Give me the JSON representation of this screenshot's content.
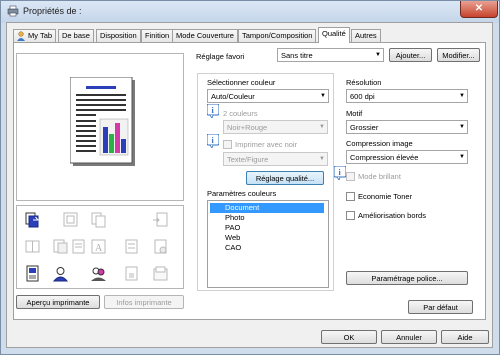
{
  "window": {
    "title": "Propriétés de :",
    "close_glyph": "✕"
  },
  "tabs": [
    {
      "label": "My Tab"
    },
    {
      "label": "De base"
    },
    {
      "label": "Disposition"
    },
    {
      "label": "Finition"
    },
    {
      "label": "Mode Couverture"
    },
    {
      "label": "Tampon/Composition"
    },
    {
      "label": "Qualité"
    },
    {
      "label": "Autres"
    }
  ],
  "favorite": {
    "label": "Réglage favori",
    "value": "Sans titre",
    "add_button": "Ajouter...",
    "modify_button": "Modifier..."
  },
  "color": {
    "select_label": "Sélectionner couleur",
    "select_value": "Auto/Couleur",
    "two_colors_label": "2 couleurs",
    "two_colors_value": "Noir+Rouge",
    "print_black_label": "Imprimer avec noir",
    "print_black_value": "Texte/Figure",
    "quality_button": "Réglage qualité..."
  },
  "color_params": {
    "label": "Paramètres couleurs",
    "items": [
      "Document",
      "Photo",
      "PAO",
      "Web",
      "CAO"
    ],
    "selected_index": 0
  },
  "resolution": {
    "label": "Résolution",
    "value": "600 dpi"
  },
  "pattern": {
    "label": "Motif",
    "value": "Grossier"
  },
  "compression": {
    "label": "Compression image",
    "value": "Compression élevée"
  },
  "options": {
    "glossy": "Mode brillant",
    "toner_save": "Economie Toner",
    "edge_enhance": "Améliorisation bords"
  },
  "font_settings_button": "Paramétrage police...",
  "default_button": "Par défaut",
  "preview_buttons": {
    "printer_view": "Aperçu imprimante",
    "printer_info": "Infos imprimante"
  },
  "footer": {
    "ok": "OK",
    "cancel": "Annuler",
    "help": "Aide"
  },
  "colors": {
    "accent": "#3399ff",
    "title_bar": "#cfdcec",
    "info_icon": "#2f6fbf",
    "chart_blue": "#2b3fb8",
    "chart_magenta": "#d33aa8",
    "chart_green": "#2bb34a"
  }
}
